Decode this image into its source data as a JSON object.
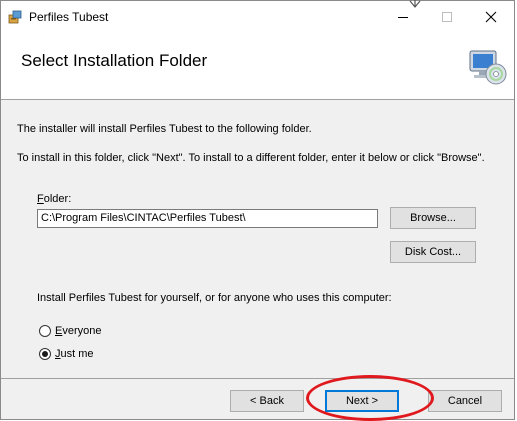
{
  "window": {
    "title": "Perfiles Tubest",
    "controls": {
      "minimize": "—",
      "maximize": "☐",
      "close": "✕"
    }
  },
  "header": {
    "title": "Select Installation Folder",
    "icon": "computer-cd-icon"
  },
  "body": {
    "intro": "The installer will install Perfiles Tubest to the following folder.",
    "instructions": "To install in this folder, click \"Next\". To install to a different folder, enter it below or click \"Browse\".",
    "folder_label_underline": "F",
    "folder_label_rest": "older:",
    "folder_value": "C:\\Program Files\\CINTAC\\Perfiles Tubest\\",
    "browse_label": "Browse...",
    "disk_cost_label": "Disk Cost...",
    "install_for_text": "Install Perfiles Tubest for yourself, or for anyone who uses this computer:",
    "options": [
      {
        "label_underline": "E",
        "label_rest": "veryone",
        "checked": false
      },
      {
        "label_underline": "J",
        "label_rest": "ust me",
        "checked": true
      }
    ]
  },
  "footer": {
    "back_label": "< Back",
    "next_label": "Next >",
    "cancel_label": "Cancel"
  },
  "colors": {
    "highlight_ellipse": "#e0191e",
    "primary_border": "#0078d7"
  }
}
